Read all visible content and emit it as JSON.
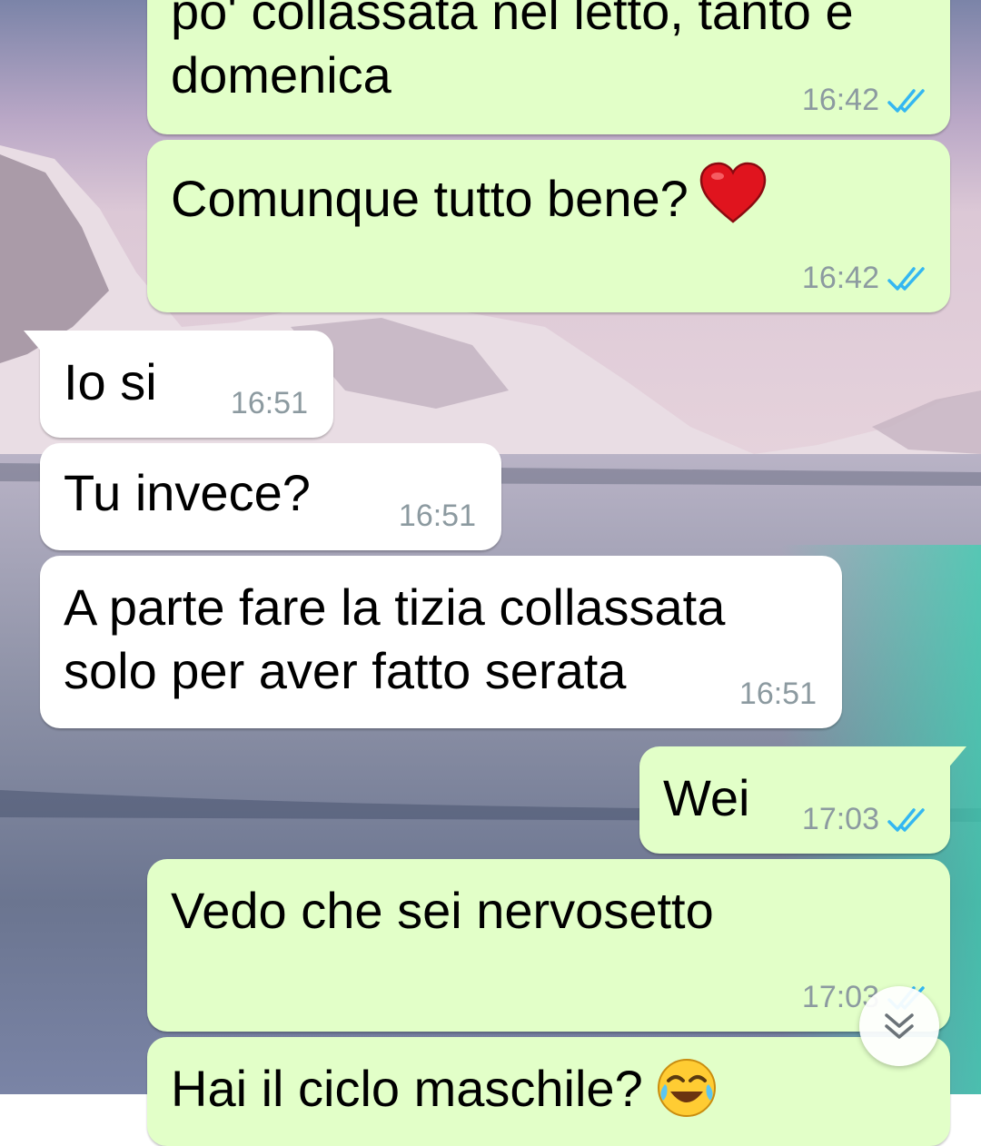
{
  "messages": [
    {
      "direction": "outgoing",
      "lines": [
        "po' collassata nel letto, tanto e",
        "domenica"
      ],
      "time": "16:42",
      "status": "read",
      "emoji": ""
    },
    {
      "direction": "outgoing",
      "lines": [
        "Comunque tutto bene?"
      ],
      "time": "16:42",
      "status": "read",
      "emoji": "heart"
    },
    {
      "direction": "incoming",
      "lines": [
        "Io si"
      ],
      "time": "16:51"
    },
    {
      "direction": "incoming",
      "lines": [
        "Tu invece?"
      ],
      "time": "16:51"
    },
    {
      "direction": "incoming",
      "lines": [
        "A parte fare la tizia collassata",
        "solo per aver fatto serata"
      ],
      "time": "16:51"
    },
    {
      "direction": "outgoing",
      "lines": [
        "Wei"
      ],
      "time": "17:03",
      "status": "read"
    },
    {
      "direction": "outgoing",
      "lines": [
        "Vedo che sei nervosetto"
      ],
      "time": "17:03",
      "status": "read"
    },
    {
      "direction": "outgoing",
      "lines": [
        "Hai il ciclo maschile?"
      ],
      "time": "",
      "status": "",
      "emoji": "tears-of-joy"
    }
  ],
  "colors": {
    "outgoing_bubble": "#e2ffc8",
    "incoming_bubble": "#ffffff",
    "timestamp": "#8c9aa0",
    "read_tick": "#34b7f1"
  },
  "icons": {
    "read_receipt": "double-check-icon",
    "scroll_button": "double-chevron-down-icon"
  }
}
